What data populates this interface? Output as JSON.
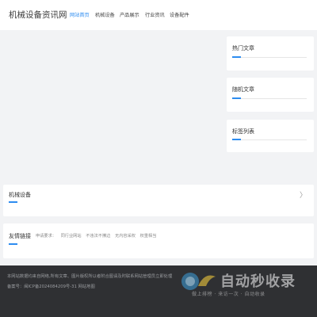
{
  "header": {
    "logo": "机械设备资讯网",
    "nav": [
      {
        "label": "网站首页",
        "active": true
      },
      {
        "label": "机械设备",
        "active": false
      },
      {
        "label": "产品展示",
        "active": false
      },
      {
        "label": "行业资讯",
        "active": false
      },
      {
        "label": "设备配件",
        "active": false
      }
    ]
  },
  "sidebar": {
    "hot_articles": "热门文章",
    "random_articles": "随机文章",
    "tag_list": "标签列表"
  },
  "main": {
    "category_title": "机械设备",
    "chevron": "〉"
  },
  "friend_links": {
    "title": "友情链接",
    "items": [
      "申请要求：",
      "同行业网站",
      "不违法不擦边",
      "无内容采权",
      "权重相当"
    ]
  },
  "footer": {
    "line1": "本网站数据均来自网络,所有文章、图片版权所以者附合图请及时联系网站管理员立即处理",
    "line2": "备案号：闽ICP备2024084209号-31 网站地图"
  },
  "watermark": {
    "text": "自动秒收录",
    "sub": "做上排榜 · 来访一次 · 自动收录"
  },
  "colors": {
    "accent": "#2d8cf0",
    "footer_bg": "#2f3033",
    "page_bg": "#f2f3f5"
  }
}
